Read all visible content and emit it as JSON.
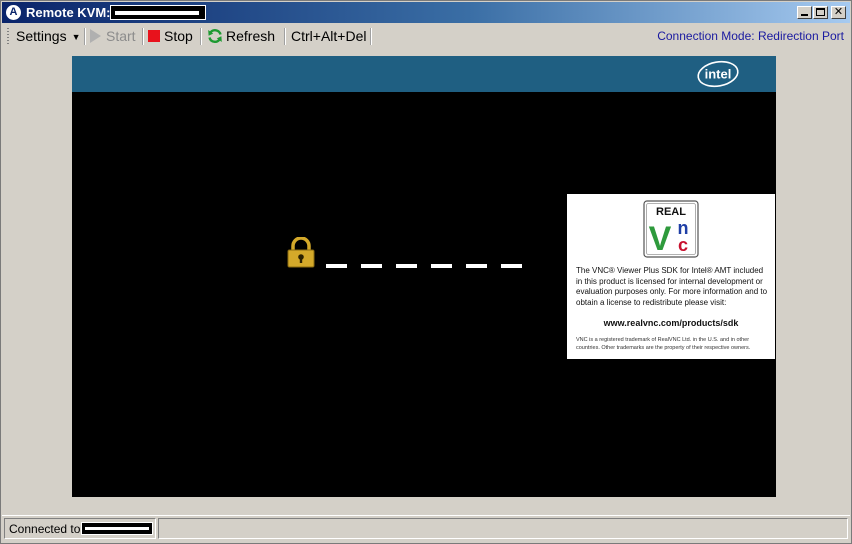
{
  "window": {
    "title": "Remote KVM:",
    "title_icon_glyph": "A"
  },
  "toolbar": {
    "settings_label": "Settings",
    "settings_caret": "▼",
    "start_label": "Start",
    "stop_label": "Stop",
    "refresh_label": "Refresh",
    "cad_label": "Ctrl+Alt+Del",
    "connection_mode": "Connection Mode: Redirection Port"
  },
  "remote": {
    "brand": "intel",
    "password_mask_count": 6
  },
  "vnc_panel": {
    "logo_real": "REAL",
    "logo_v": "V",
    "logo_n": "n",
    "logo_c": "c",
    "body": "The VNC® Viewer Plus SDK for Intel® AMT included in this product is licensed for internal development or evaluation purposes only.  For more information and to obtain a license to redistribute please visit:",
    "url": "www.realvnc.com/products/sdk",
    "fine_print": "VNC is a registered trademark of RealVNC Ltd. in the U.S. and in other countries. Other trademarks are the property of their respective owners."
  },
  "status": {
    "connected_label": "Connected to"
  },
  "colors": {
    "intel_bar": "#1f5f82",
    "stop_red": "#e8121c",
    "refresh_green": "#1e9a32",
    "lock_gold": "#d4a92a",
    "vnc_red": "#c8102e",
    "vnc_green": "#2e9a3c",
    "vnc_blue": "#1f3fa6"
  }
}
